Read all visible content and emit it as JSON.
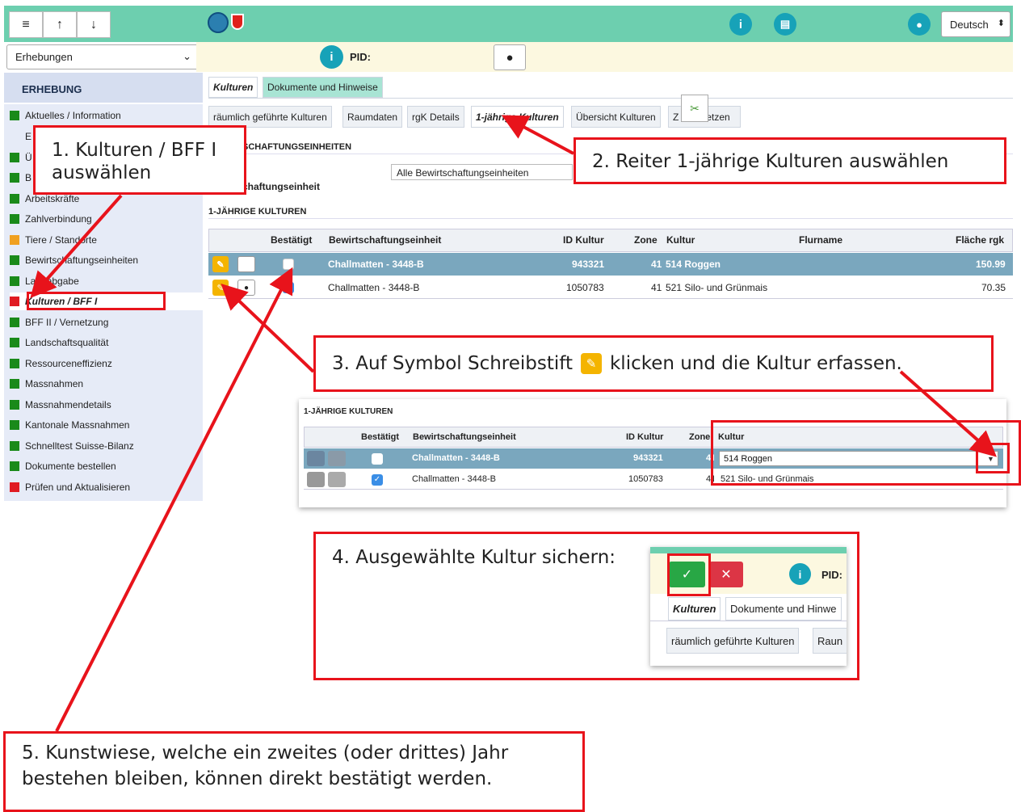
{
  "topbar": {
    "menu_icon": "hamburger-icon",
    "up_icon": "arrow-up-icon",
    "down_icon": "arrow-down-icon",
    "info_icon": "info-icon",
    "book_icon": "book-icon",
    "user_icon": "user-icon",
    "language": "Deutsch",
    "color": "#6dcfaf"
  },
  "survey_select": {
    "value": "Erhebungen"
  },
  "pid_label": "PID:",
  "sidebar": {
    "heading": "ERHEBUNG",
    "items": [
      {
        "label": "Aktuelles / Information",
        "color": "#1a8a1a"
      },
      {
        "label": "E",
        "color": ""
      },
      {
        "label": "Ü",
        "color": "#1a8a1a"
      },
      {
        "label": "B",
        "color": "#1a8a1a"
      },
      {
        "label": "Arbeitskräfte",
        "color": "#1a8a1a"
      },
      {
        "label": "Zahlverbindung",
        "color": "#1a8a1a"
      },
      {
        "label": "Tiere / Standorte",
        "color": "#f0a020"
      },
      {
        "label": "Bewirtschaftungseinheiten",
        "color": "#1a8a1a"
      },
      {
        "label": "Landabgabe",
        "color": "#1a8a1a"
      },
      {
        "label": "Kulturen / BFF I",
        "color": "#e01b22"
      },
      {
        "label": "BFF II / Vernetzung",
        "color": "#1a8a1a"
      },
      {
        "label": "Landschaftsqualität",
        "color": "#1a8a1a"
      },
      {
        "label": "Ressourceneffizienz",
        "color": "#1a8a1a"
      },
      {
        "label": "Massnahmen",
        "color": "#1a8a1a"
      },
      {
        "label": "Massnahmendetails",
        "color": "#1a8a1a"
      },
      {
        "label": "Kantonale Massnahmen",
        "color": "#1a8a1a"
      },
      {
        "label": "Schnelltest Suisse-Bilanz",
        "color": "#1a8a1a"
      },
      {
        "label": "Dokumente bestellen",
        "color": "#1a8a1a"
      },
      {
        "label": "Prüfen und Aktualisieren",
        "color": "#e01b22"
      }
    ]
  },
  "main_tabs": [
    "Kulturen",
    "Dokumente und Hinweise"
  ],
  "sub_tabs": [
    "räumlich geführte Kulturen",
    "Raumdaten",
    "rgK Details",
    "1-jährige Kulturen",
    "Übersicht Kulturen",
    "Z",
    "etzen"
  ],
  "section1": {
    "title": "SCHAFTUNGSEINHEITEN",
    "label_l": "l",
    "label": "chaftungseinheit",
    "select_value": "Alle Bewirtschaftungseinheiten"
  },
  "section2": {
    "title": "1-JÄHRIGE KULTUREN",
    "headers": [
      "Bestätigt",
      "Bewirtschaftungseinheit",
      "ID Kultur",
      "Zone",
      "Kultur",
      "Flurname",
      "Fläche rgk"
    ],
    "rows": [
      {
        "unit": "Challmatten - 3448-B",
        "id": "943321",
        "zone": "41",
        "kultur": "514 Roggen",
        "flurname": "",
        "flaeche": "150.99",
        "checked": false
      },
      {
        "unit": "Challmatten - 3448-B",
        "id": "1050783",
        "zone": "41",
        "kultur": "521 Silo- und Grünmais",
        "flurname": "",
        "flaeche": "70.35",
        "checked": true
      }
    ]
  },
  "inset1": {
    "title": "1-JÄHRIGE KULTUREN",
    "headers": [
      "Bestätigt",
      "Bewirtschaftungseinheit",
      "ID Kultur",
      "Zone",
      "Kultur"
    ],
    "rows": [
      {
        "unit": "Challmatten - 3448-B",
        "id": "943321",
        "zone": "41",
        "kultur": "514 Roggen"
      },
      {
        "unit": "Challmatten - 3448-B",
        "id": "1050783",
        "zone": "41",
        "kultur": "521 Silo- und Grünmais"
      }
    ]
  },
  "inset2": {
    "pid": "PID:",
    "tabs": [
      "Kulturen",
      "Dokumente und Hinwe"
    ],
    "subtab": "räumlich geführte Kulturen",
    "subtab2": "Raun"
  },
  "callouts": {
    "c1": "1. Kulturen / BFF I auswählen",
    "c2": "2. Reiter 1-jährige Kulturen auswählen",
    "c3a": "3. Auf Symbol Schreibstift",
    "c3b": "klicken und die Kultur erfassen.",
    "c4": "4. Ausgewählte Kultur sichern:",
    "c5": "5. Kunstwiese, welche ein zweites (oder drittes) Jahr bestehen bleiben, können direkt bestätigt werden."
  }
}
